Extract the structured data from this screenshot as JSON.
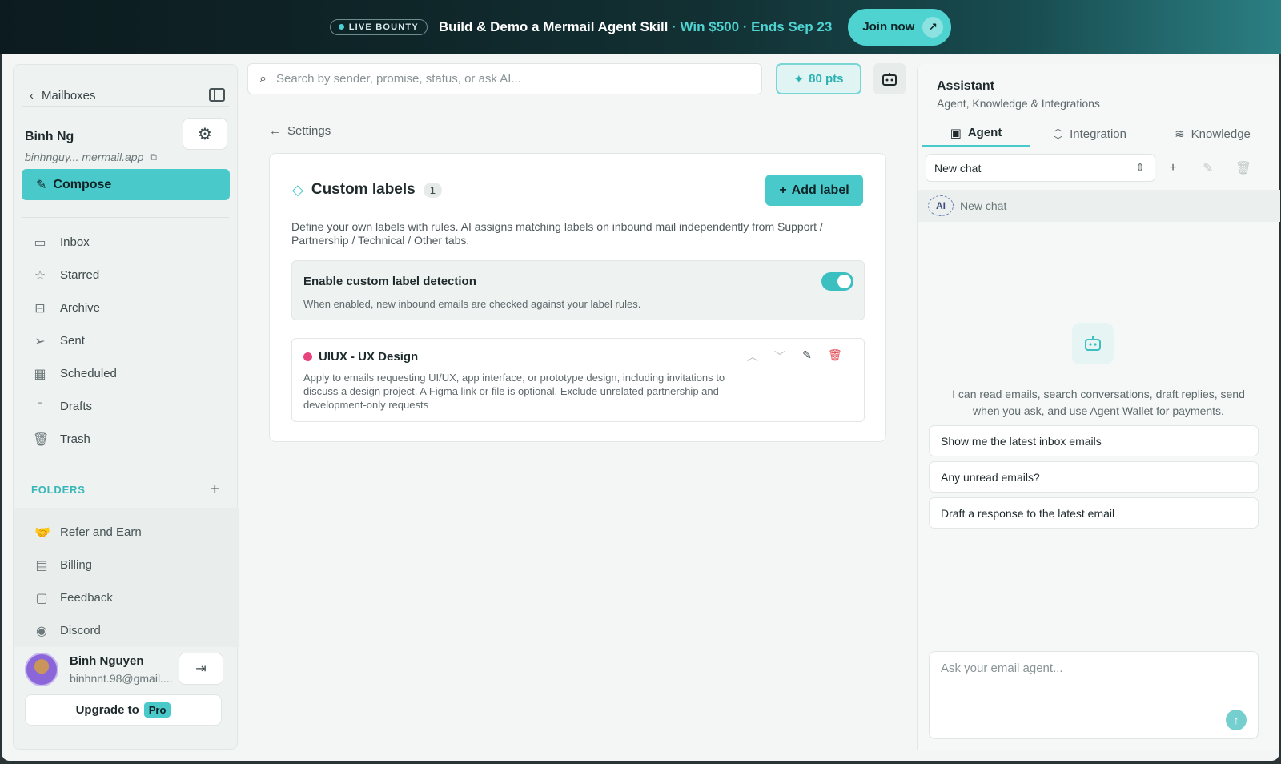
{
  "banner": {
    "badge": "LIVE BOUNTY",
    "title": "Build & Demo a Mermail Agent Skill",
    "accent": " · Win $500 · Ends Sep 23",
    "cta": "Join now",
    "cta_icon": "arrow-up-right-icon"
  },
  "sidebar": {
    "mailboxes_label": "Mailboxes",
    "user_name": "Binh Ng",
    "user_email": "binhnguy... mermail.app",
    "compose_label": "Compose",
    "nav": [
      {
        "label": "Inbox",
        "icon": "inbox-icon"
      },
      {
        "label": "Starred",
        "icon": "star-icon"
      },
      {
        "label": "Archive",
        "icon": "archive-icon"
      },
      {
        "label": "Sent",
        "icon": "send-icon"
      },
      {
        "label": "Scheduled",
        "icon": "calendar-icon"
      },
      {
        "label": "Drafts",
        "icon": "draft-icon"
      },
      {
        "label": "Trash",
        "icon": "trash-icon"
      }
    ],
    "folders_label": "FOLDERS",
    "extra": [
      {
        "label": "Refer and Earn",
        "icon": "handshake-icon"
      },
      {
        "label": "Billing",
        "icon": "billing-icon"
      },
      {
        "label": "Feedback",
        "icon": "feedback-icon"
      },
      {
        "label": "Discord",
        "icon": "discord-icon"
      }
    ],
    "profile": {
      "name": "Binh Nguyen",
      "email": "binhnnt.98@gmail...."
    },
    "upgrade_label": "Upgrade to",
    "upgrade_badge": "Pro"
  },
  "toolbar": {
    "search_placeholder": "Search by sender, promise, status, or ask AI...",
    "points": "80 pts"
  },
  "settings": {
    "back_label": "Settings",
    "title": "Custom labels",
    "count": "1",
    "add_label": "Add label",
    "description": "Define your own labels with rules. AI assigns matching labels on inbound mail independently from Support / Partnership / Technical / Other tabs.",
    "toggle_title": "Enable custom label detection",
    "toggle_desc": "When enabled, new inbound emails are checked against your label rules.",
    "toggle_on": true,
    "labels": [
      {
        "name": "UIUX - UX Design",
        "color": "#e6437d",
        "rule": "Apply to emails requesting UI/UX, app interface, or prototype design, including invitations to discuss a design project. A Figma link or file is optional. Exclude unrelated partnership and development-only requests"
      }
    ]
  },
  "assistant": {
    "title": "Assistant",
    "subtitle": "Agent, Knowledge & Integrations",
    "tabs": [
      {
        "label": "Agent",
        "icon": "robot-icon"
      },
      {
        "label": "Integration",
        "icon": "puzzle-icon"
      },
      {
        "label": "Knowledge",
        "icon": "database-icon"
      }
    ],
    "chat_select": "New chat",
    "chat_item_badge": "AI",
    "chat_item_label": "New chat",
    "description": "I can read emails, search conversations, draft replies, send when you ask, and use Agent Wallet for payments.",
    "suggestions": [
      "Show me the latest inbox emails",
      "Any unread emails?",
      "Draft a response to the latest email"
    ],
    "input_placeholder": "Ask your email agent..."
  },
  "colors": {
    "accent": "#4ac9cb",
    "label_dot": "#e6437d",
    "delete": "#e0414a"
  }
}
